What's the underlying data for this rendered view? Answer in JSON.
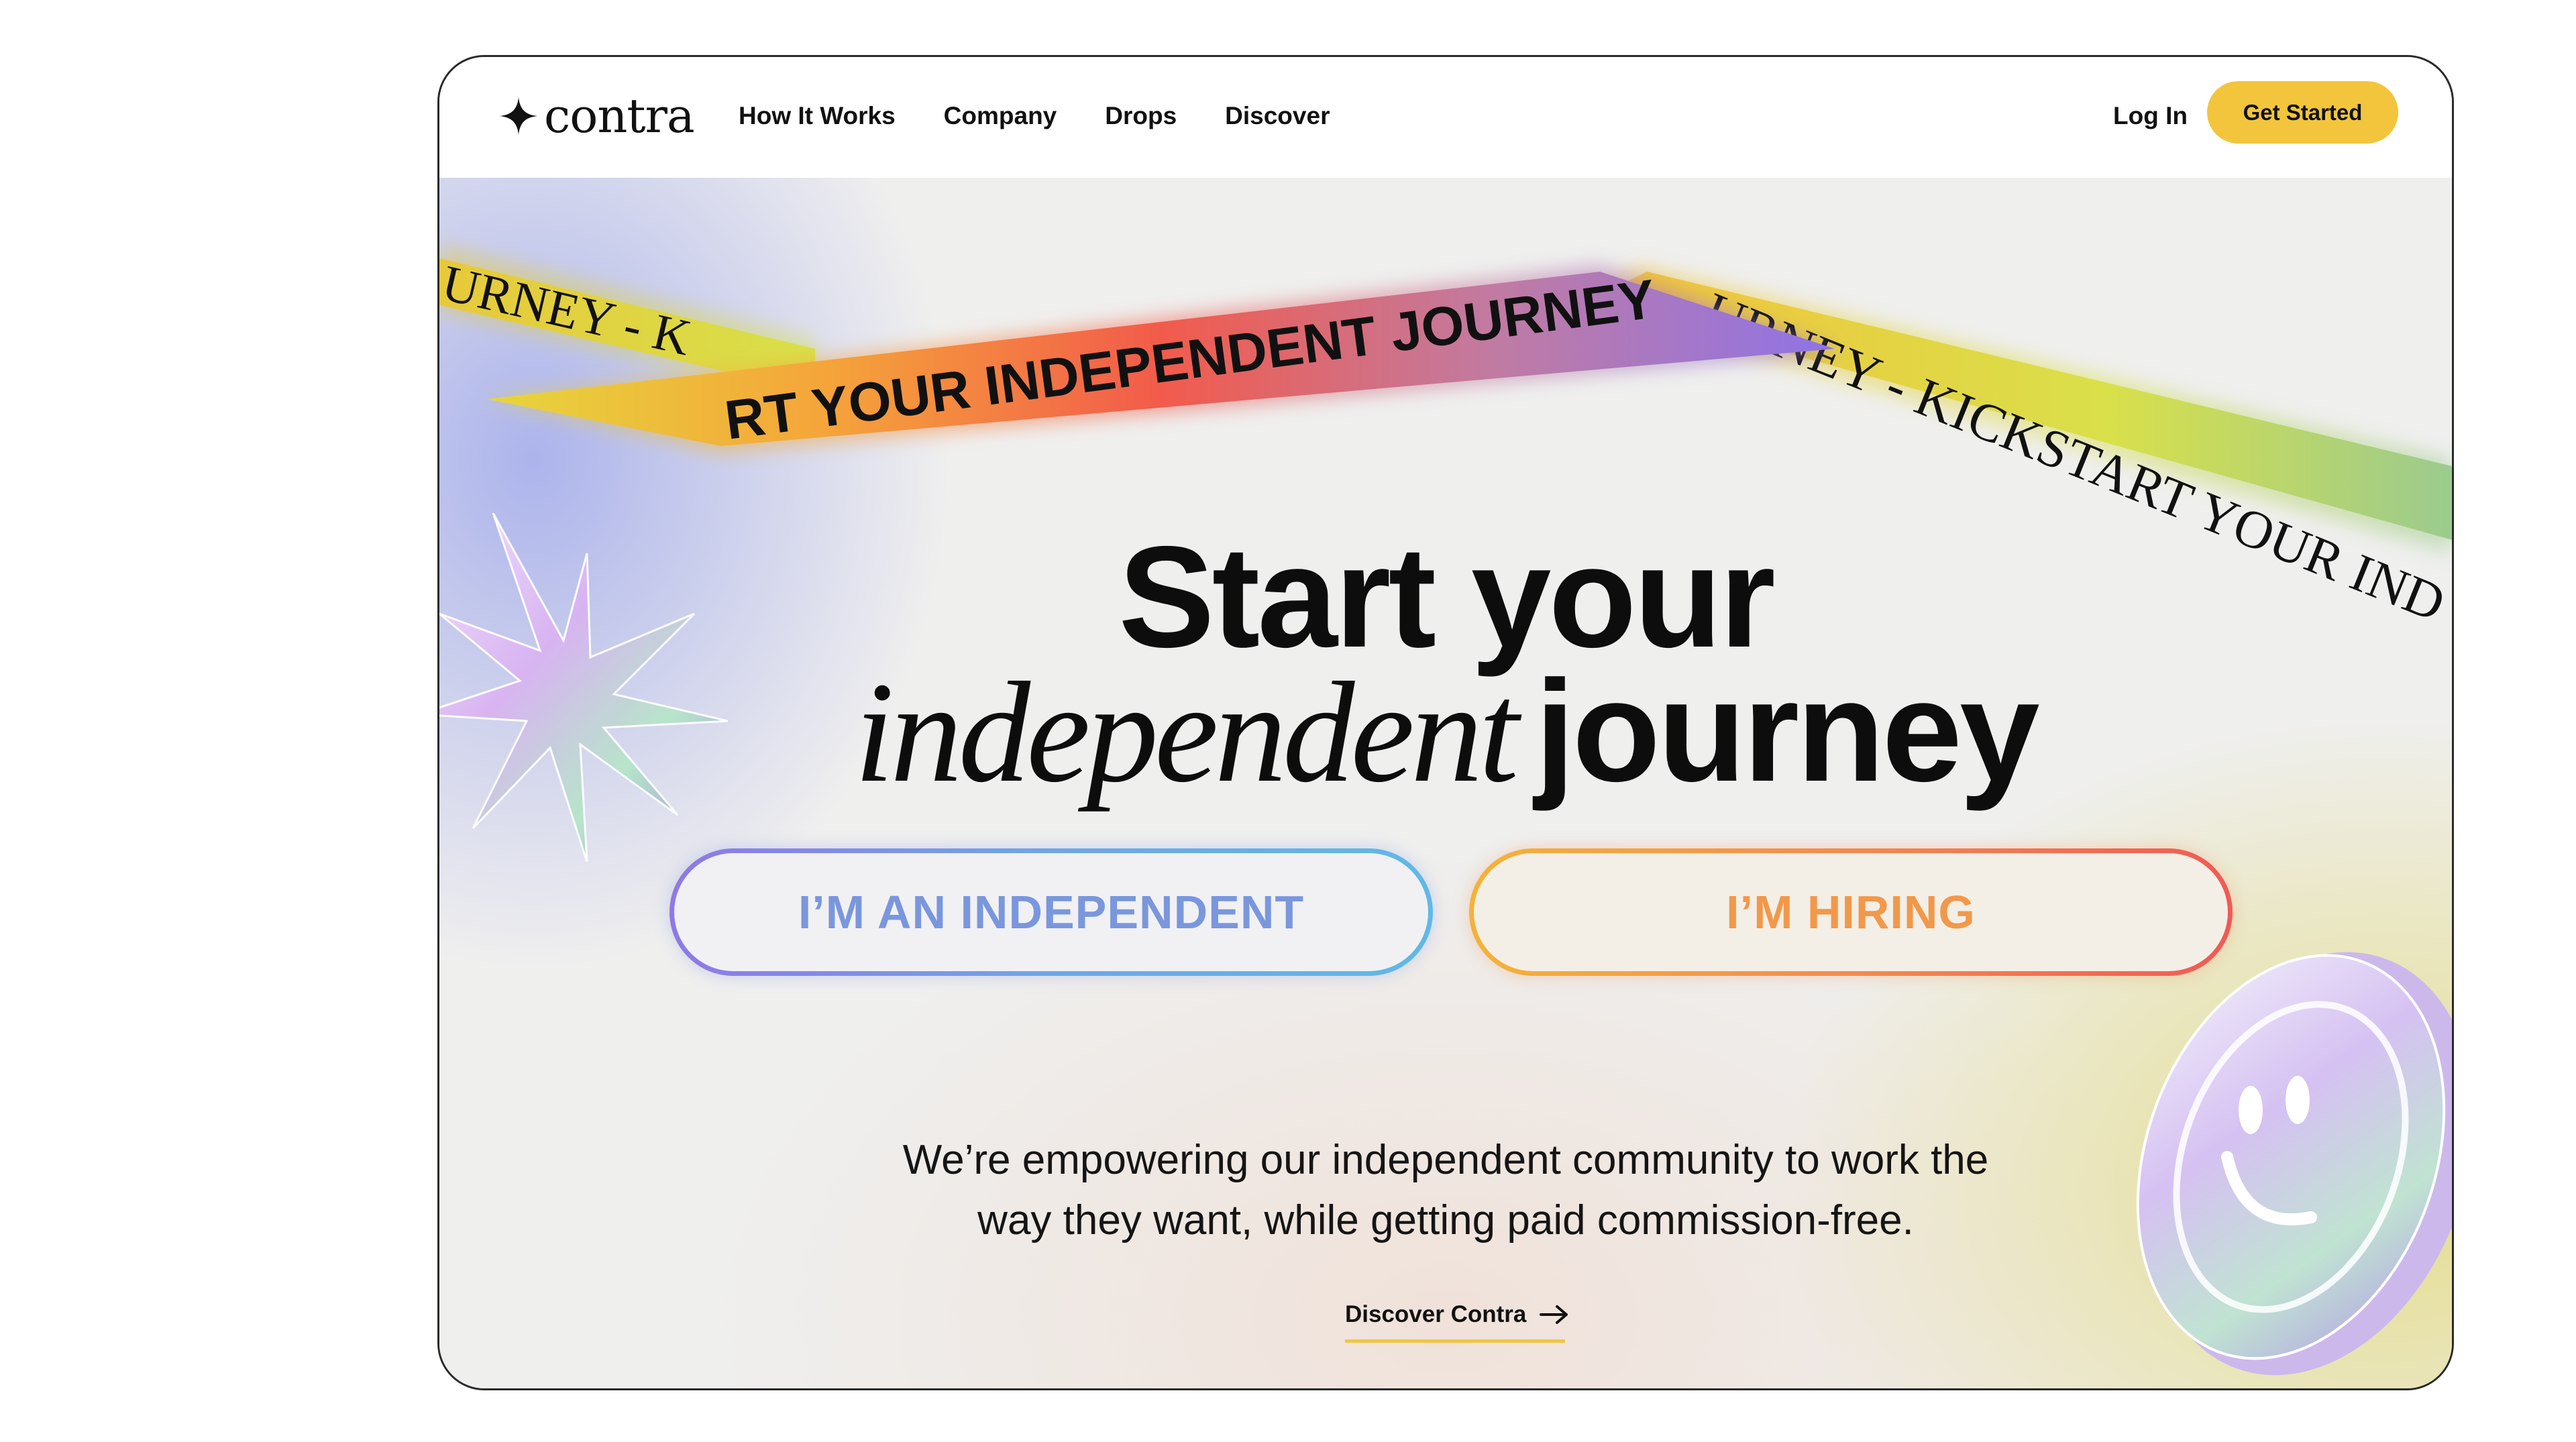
{
  "brand": {
    "name": "contra"
  },
  "nav": {
    "links": [
      "How It Works",
      "Company",
      "Drops",
      "Discover"
    ],
    "login": "Log In",
    "cta": "Get Started"
  },
  "ribbons": {
    "top_text": "RT YOUR INDEPENDENT JOURNEY",
    "left_text": "URNEY - K",
    "right_text": "URNEY - KICKSTART YOUR IND"
  },
  "hero": {
    "headline_line1": "Start your",
    "headline_italic": "independent",
    "headline_line2_rest": "journey",
    "button_independent": "I’M AN INDEPENDENT",
    "button_hiring": "I’M HIRING",
    "subtext_line1": "We’re empowering our independent community to work the",
    "subtext_line2": "way they want, while getting paid commission-free.",
    "discover_link": "Discover Contra"
  },
  "colors": {
    "accent_yellow": "#f2c53d",
    "independent_gradient": [
      "#8e79e6",
      "#5fb9e6"
    ],
    "hiring_gradient": [
      "#f3b33a",
      "#f05a55"
    ]
  },
  "icons": [
    "contra-logo-icon",
    "arrow-right-icon",
    "starburst-icon",
    "smiley-coin-icon"
  ]
}
